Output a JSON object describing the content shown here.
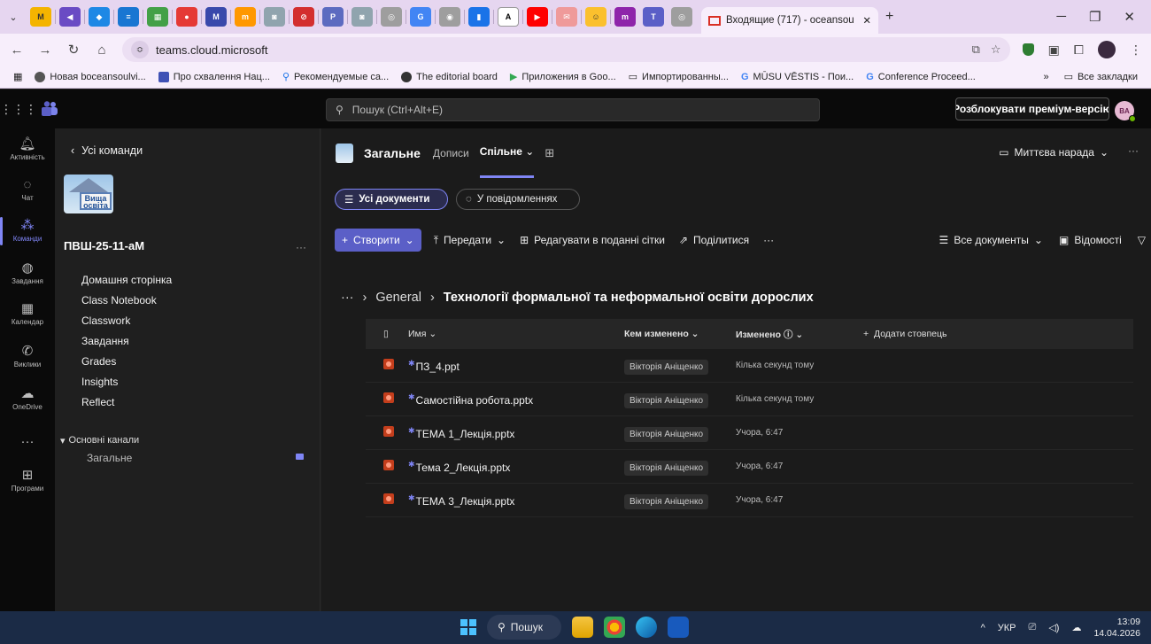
{
  "browser": {
    "active_tab_title": "Входящие (717) - oceansou",
    "url": "teams.cloud.microsoft",
    "bookmarks": [
      "Новая boceansoulvi...",
      "Про схвалення Нац...",
      "Рекомендуемые са...",
      "The editorial board",
      "Приложения в Goo...",
      "Импортированны...",
      "MŪSU VĒSTIS - Пои...",
      "Conference Proceed..."
    ],
    "all_bookmarks": "Все закладки"
  },
  "teams": {
    "search_placeholder": "Пошук (Ctrl+Alt+E)",
    "premium_button": "Розблокувати преміум-версію",
    "avatar_initials": "BA",
    "rail": [
      {
        "label": "Активність",
        "icon": "bell-icon"
      },
      {
        "label": "Чат",
        "icon": "chat-icon"
      },
      {
        "label": "Команди",
        "icon": "teams-icon"
      },
      {
        "label": "Завдання",
        "icon": "assignments-icon"
      },
      {
        "label": "Календар",
        "icon": "calendar-icon"
      },
      {
        "label": "Виклики",
        "icon": "phone-icon"
      },
      {
        "label": "OneDrive",
        "icon": "onedrive-icon"
      },
      {
        "label": "",
        "icon": "more-icon"
      },
      {
        "label": "Програми",
        "icon": "apps-icon"
      }
    ],
    "team_pane": {
      "back_label": "Усі команди",
      "team_name": "ПВШ-25-11-аМ",
      "team_image_text": "Вища освіта",
      "links": [
        "Домашня сторінка",
        "Class Notebook",
        "Classwork",
        "Завдання",
        "Grades",
        "Insights",
        "Reflect"
      ],
      "section_header": "Основні канали",
      "channel": "Загальне"
    },
    "channel": {
      "title": "Загальне",
      "tabs": [
        "Дописи",
        "Спільне"
      ],
      "selected_tab": "Спільне",
      "meet_button": "Миттєва нарада"
    },
    "filters": {
      "all_docs": "Усі документи",
      "in_messages": "У повідомленнях"
    },
    "command_bar": {
      "create": "Створити",
      "upload": "Передати",
      "grid_edit": "Редагувати в поданні сітки",
      "share": "Поділитися",
      "view": "Все документы",
      "details": "Відомості"
    },
    "breadcrumb": {
      "parent": "General",
      "current": "Технології формальної та неформальної освіти дорослих"
    },
    "table": {
      "columns": {
        "name": "Имя",
        "modified_by": "Кем изменено",
        "modified": "Изменено",
        "add_column": "Додати стовпець"
      },
      "rows": [
        {
          "name": "ПЗ_4.ppt",
          "modified_by": "Вікторія Аніщенко",
          "modified": "Кілька секунд тому"
        },
        {
          "name": "Самостійна робота.pptx",
          "modified_by": "Вікторія Аніщенко",
          "modified": "Кілька секунд тому"
        },
        {
          "name": "ТЕМА 1_Лекція.pptx",
          "modified_by": "Вікторія Аніщенко",
          "modified": "Учора, 6:47"
        },
        {
          "name": "Тема 2_Лекція.pptx",
          "modified_by": "Вікторія Аніщенко",
          "modified": "Учора, 6:47"
        },
        {
          "name": "ТЕМА 3_Лекція.pptx",
          "modified_by": "Вікторія Аніщенко",
          "modified": "Учора, 6:47"
        }
      ]
    }
  },
  "taskbar": {
    "search_label": "Пошук",
    "language": "УКР",
    "time": "13:09",
    "date": "14.04.2026"
  }
}
